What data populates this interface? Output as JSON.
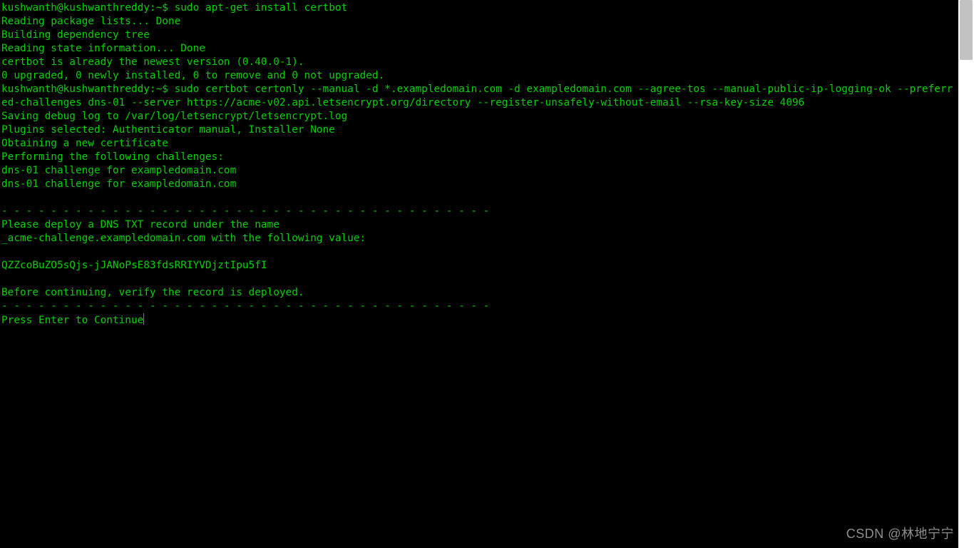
{
  "terminal": {
    "prompt1": "kushwanth@kushwanthreddy:~$ ",
    "cmd1": "sudo apt-get install certbot",
    "out1": [
      "Reading package lists... Done",
      "Building dependency tree",
      "Reading state information... Done",
      "certbot is already the newest version (0.40.0-1).",
      "0 upgraded, 0 newly installed, 0 to remove and 0 not upgraded."
    ],
    "prompt2": "kushwanth@kushwanthreddy:~$ ",
    "cmd2": "sudo certbot certonly --manual -d *.exampledomain.com -d exampledomain.com --agree-tos --manual-public-ip-logging-ok --preferred-challenges dns-01 --server https://acme-v02.api.letsencrypt.org/directory --register-unsafely-without-email --rsa-key-size 4096",
    "out2": [
      "Saving debug log to /var/log/letsencrypt/letsencrypt.log",
      "Plugins selected: Authenticator manual, Installer None",
      "Obtaining a new certificate",
      "Performing the following challenges:",
      "dns-01 challenge for exampledomain.com",
      "dns-01 challenge for exampledomain.com",
      "",
      "- - - - - - - - - - - - - - - - - - - - - - - - - - - - - - - - - - - - - - - -",
      "Please deploy a DNS TXT record under the name",
      "_acme-challenge.exampledomain.com with the following value:",
      "",
      "QZZcoBuZO5sQjs-jJANoPsE83fdsRRIYVDjztIpu5fI",
      "",
      "Before continuing, verify the record is deployed.",
      "- - - - - - - - - - - - - - - - - - - - - - - - - - - - - - - - - - - - - - - -"
    ],
    "final_prompt": "Press Enter to Continue"
  },
  "watermark": "CSDN @林地宁宁"
}
